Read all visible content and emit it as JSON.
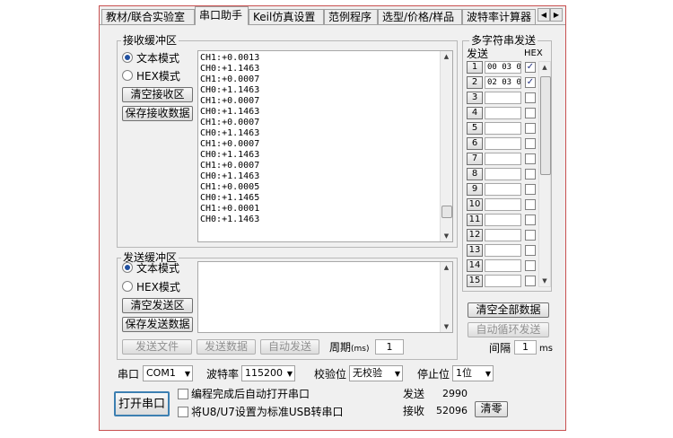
{
  "tabs": [
    "教材/联合实验室",
    "串口助手",
    "Keil仿真设置",
    "范例程序",
    "选型/价格/样品",
    "波特率计算器"
  ],
  "tab_scroll": {
    "left": "◀",
    "right": "▶"
  },
  "receive": {
    "title": "接收缓冲区",
    "mode_text": "文本模式",
    "mode_hex": "HEX模式",
    "clear_label": "清空接收区",
    "save_label": "保存接收数据",
    "lines": [
      "CH1:+0.0013",
      "CH0:+1.1463",
      "CH1:+0.0007",
      "CH0:+1.1463",
      "CH1:+0.0007",
      "CH0:+1.1463",
      "CH1:+0.0007",
      "CH0:+1.1463",
      "CH1:+0.0007",
      "CH0:+1.1463",
      "CH1:+0.0007",
      "CH0:+1.1463",
      "CH1:+0.0005",
      "CH0:+1.1465",
      "CH1:+0.0001",
      "CH0:+1.1463"
    ]
  },
  "send": {
    "title": "发送缓冲区",
    "mode_text": "文本模式",
    "mode_hex": "HEX模式",
    "clear_label": "清空发送区",
    "save_label": "保存发送数据",
    "send_file": "发送文件",
    "send_data": "发送数据",
    "auto_send": "自动发送",
    "period_label": "周期",
    "period_unit": "(ms)",
    "period_value": "1"
  },
  "multi": {
    "title": "多字符串发送",
    "send_header": "发送",
    "hex_header": "HEX",
    "rows": [
      {
        "num": "1",
        "value": "00 03 0",
        "hex": true
      },
      {
        "num": "2",
        "value": "02 03 0",
        "hex": true
      },
      {
        "num": "3",
        "value": "",
        "hex": false
      },
      {
        "num": "4",
        "value": "",
        "hex": false
      },
      {
        "num": "5",
        "value": "",
        "hex": false
      },
      {
        "num": "6",
        "value": "",
        "hex": false
      },
      {
        "num": "7",
        "value": "",
        "hex": false
      },
      {
        "num": "8",
        "value": "",
        "hex": false
      },
      {
        "num": "9",
        "value": "",
        "hex": false
      },
      {
        "num": "10",
        "value": "",
        "hex": false
      },
      {
        "num": "11",
        "value": "",
        "hex": false
      },
      {
        "num": "12",
        "value": "",
        "hex": false
      },
      {
        "num": "13",
        "value": "",
        "hex": false
      },
      {
        "num": "14",
        "value": "",
        "hex": false
      },
      {
        "num": "15",
        "value": "",
        "hex": false
      }
    ],
    "clear_all": "清空全部数据",
    "auto_loop": "自动循环发送",
    "interval_label": "间隔",
    "interval_value": "1",
    "interval_unit": "ms"
  },
  "bottom": {
    "port_label": "串口",
    "port_value": "COM1",
    "baud_label": "波特率",
    "baud_value": "115200",
    "parity_label": "校验位",
    "parity_value": "无校验",
    "stop_label": "停止位",
    "stop_value": "1位",
    "open_port": "打开串口",
    "auto_open": "编程完成后自动打开串口",
    "usb_option": "将U8/U7设置为标准USB转串口",
    "sent_label": "发送",
    "sent_value": "2990",
    "recv_label": "接收",
    "recv_value": "52096",
    "clear_count": "清零"
  },
  "glyphs": {
    "dropdown": "▼",
    "check": "✓",
    "up": "▲",
    "down": "▼"
  }
}
